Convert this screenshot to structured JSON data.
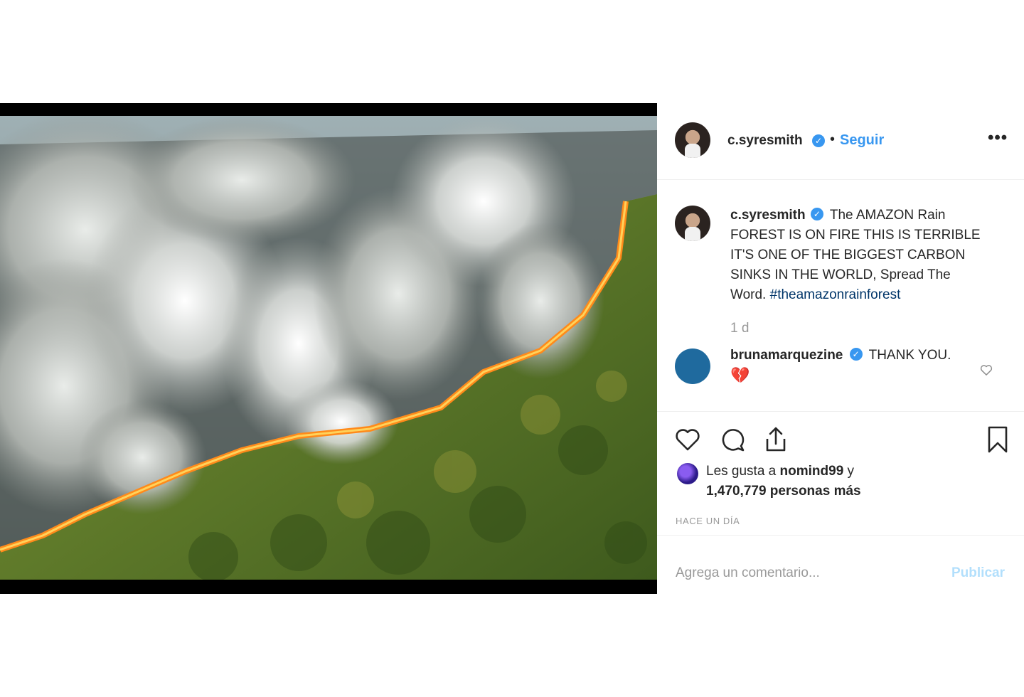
{
  "post": {
    "author": "c.syresmith",
    "follow_label": "Seguir",
    "separator": "•",
    "more_label": "•••",
    "caption_text": "The AMAZON Rain FOREST IS ON FIRE THIS IS TERRIBLE IT'S ONE OF THE BIGGEST CARBON SINKS IN THE WORLD, Spread The Word.",
    "hashtag": "#theamazonrainforest",
    "caption_age": "1 d",
    "verified_mark": "✓"
  },
  "reply": {
    "author": "brunamarquezine",
    "text": "THANK YOU.",
    "emoji": "💔"
  },
  "likes": {
    "prefix": "Les gusta a",
    "first_user": "nomind99",
    "conjunction": "y",
    "others": "1,470,779 personas más"
  },
  "time_ago": "HACE UN DÍA",
  "add_comment": {
    "placeholder": "Agrega un comentario...",
    "publish_label": "Publicar"
  },
  "icons": [
    "heart-icon",
    "comment-icon",
    "share-icon",
    "bookmark-icon",
    "more-icon",
    "verified-icon"
  ],
  "colors": {
    "link_blue": "#3897f0",
    "hashtag": "#003569",
    "publish_disabled": "#b2dffc",
    "muted": "#999999"
  }
}
